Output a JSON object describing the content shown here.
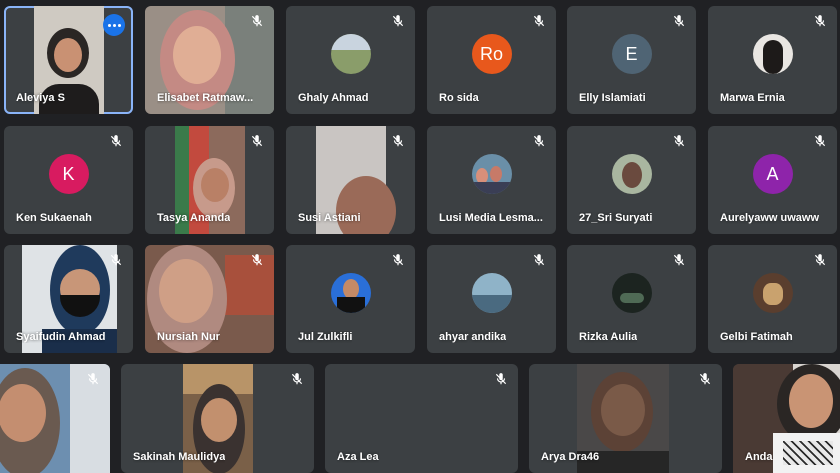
{
  "colors": {
    "background": "#202124",
    "tile": "#3c4043",
    "active_border": "#8ab4f8",
    "more_button": "#1a73e8",
    "avatar_ro": "#e8581c",
    "avatar_e": "#4f6474",
    "avatar_k": "#d81b60",
    "avatar_a": "#8e24aa"
  },
  "participants": [
    {
      "name": "Aleviya S",
      "muted": false
    },
    {
      "name": "Elisabet Ratmaw...",
      "muted": true
    },
    {
      "name": "Ghaly Ahmad",
      "muted": true
    },
    {
      "name": "Ro sida",
      "muted": true,
      "initials": "Ro"
    },
    {
      "name": "Elly Islamiati",
      "muted": true,
      "initials": "E"
    },
    {
      "name": "Marwa Ernia",
      "muted": true
    },
    {
      "name": "Ken Sukaenah",
      "muted": true,
      "initials": "K"
    },
    {
      "name": "Tasya Ananda",
      "muted": true
    },
    {
      "name": "Susi Astiani",
      "muted": true
    },
    {
      "name": "Lusi Media Lesma...",
      "muted": true
    },
    {
      "name": "27_Sri Suryati",
      "muted": true
    },
    {
      "name": "Aurelyaww uwaww",
      "muted": true,
      "initials": "A"
    },
    {
      "name": "Syaifudin Ahmad",
      "muted": true
    },
    {
      "name": "Nursiah Nur",
      "muted": true
    },
    {
      "name": "Jul Zulkifli",
      "muted": true
    },
    {
      "name": "ahyar andika",
      "muted": true
    },
    {
      "name": "Rizka Aulia",
      "muted": true
    },
    {
      "name": "Gelbi Fatimah",
      "muted": true
    },
    {
      "name": "",
      "muted": true
    },
    {
      "name": "Sakinah Maulidya",
      "muted": true
    },
    {
      "name": "Aza Lea",
      "muted": true
    },
    {
      "name": "Arya Dra46",
      "muted": true
    },
    {
      "name": "Anda",
      "muted": true
    }
  ]
}
